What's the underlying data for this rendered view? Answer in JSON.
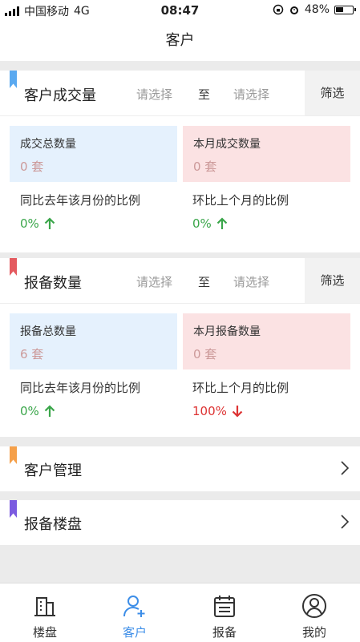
{
  "status_bar": {
    "carrier": "中国移动",
    "network": "4G",
    "time": "08:47",
    "battery": "48%",
    "battery_level": 0.48
  },
  "nav": {
    "title": "客户"
  },
  "deal_section": {
    "title": "客户成交量",
    "flag_color": "#5aa9f0",
    "start_placeholder": "请选择",
    "to_label": "至",
    "end_placeholder": "请选择",
    "filter_label": "筛选",
    "total_label": "成交总数量",
    "total_value": "0 套",
    "month_label": "本月成交数量",
    "month_value": "0 套",
    "yoy_label": "同比去年该月份的比例",
    "yoy_value": "0%",
    "yoy_trend": "up",
    "mom_label": "环比上个月的比例",
    "mom_value": "0%",
    "mom_trend": "up"
  },
  "report_section": {
    "title": "报备数量",
    "flag_color": "#e45a5f",
    "start_placeholder": "请选择",
    "to_label": "至",
    "end_placeholder": "请选择",
    "filter_label": "筛选",
    "total_label": "报备总数量",
    "total_value": "6 套",
    "month_label": "本月报备数量",
    "month_value": "0 套",
    "yoy_label": "同比去年该月份的比例",
    "yoy_value": "0%",
    "yoy_trend": "up",
    "mom_label": "环比上个月的比例",
    "mom_value": "100%",
    "mom_trend": "down"
  },
  "menus": [
    {
      "label": "客户管理",
      "flag_color": "#f5a04a"
    },
    {
      "label": "报备楼盘",
      "flag_color": "#7b5be0"
    }
  ],
  "tabs": [
    {
      "label": "楼盘",
      "icon": "building-icon"
    },
    {
      "label": "客户",
      "icon": "person-add-icon",
      "active": true
    },
    {
      "label": "报备",
      "icon": "calendar-icon"
    },
    {
      "label": "我的",
      "icon": "user-circle-icon"
    }
  ],
  "colors": {
    "accent": "#3d8ee8",
    "up": "#3aa64a",
    "down": "#d33"
  }
}
